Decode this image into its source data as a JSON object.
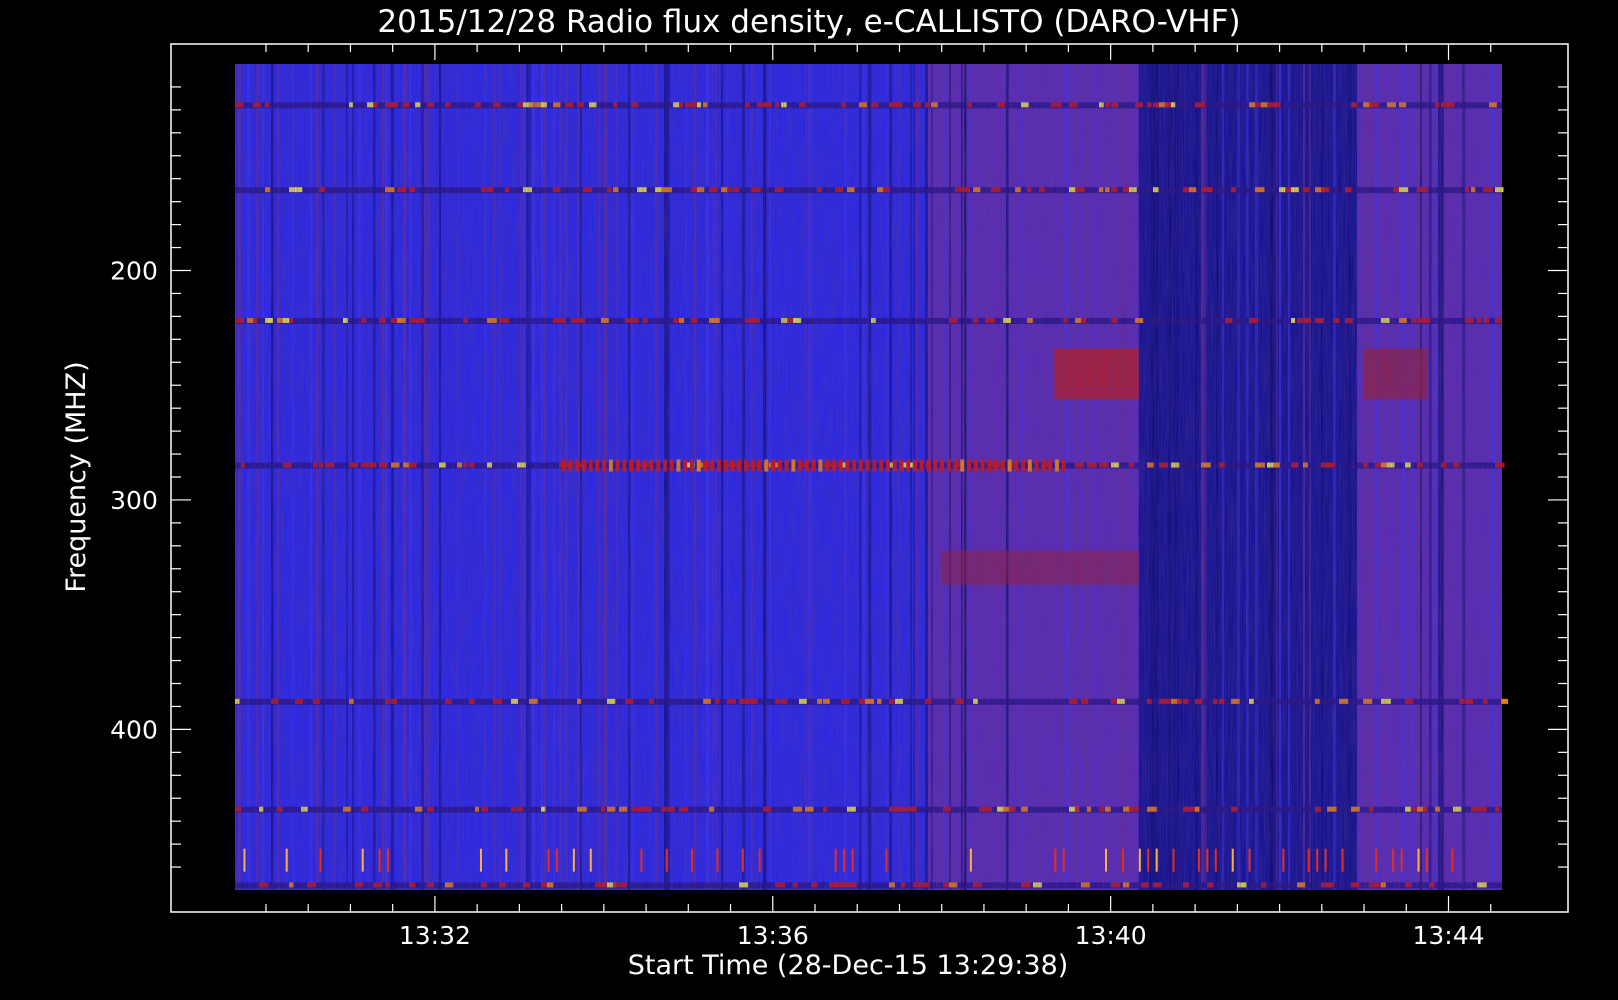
{
  "chart_data": {
    "type": "heatmap",
    "title": "2015/12/28  Radio flux density, e-CALLISTO (DARO-VHF)",
    "xlabel": "Start Time (28-Dec-15 13:29:38)",
    "ylabel": "Frequency (MHZ)",
    "x_ticks": [
      "13:32",
      "13:36",
      "13:40",
      "13:44"
    ],
    "y_ticks": [
      "200",
      "300",
      "400"
    ],
    "x_range_minutes": [
      "13:29:38",
      "13:44:38"
    ],
    "y_range_mhz": [
      110,
      470
    ],
    "colormap": [
      "#000000",
      "#1a1aff",
      "#5a2aa0",
      "#cc1010",
      "#ff8c00",
      "#ffff40"
    ],
    "segments": [
      {
        "start": "13:29:38",
        "end": "13:37:50",
        "level": "blue background"
      },
      {
        "start": "13:37:50",
        "end": "13:40:20",
        "level": "mixed red/purple"
      },
      {
        "start": "13:40:20",
        "end": "13:42:55",
        "level": "dark blue/black"
      },
      {
        "start": "13:42:55",
        "end": "13:44:38",
        "level": "mixed red/purple"
      }
    ],
    "bright_bands_mhz": [
      128,
      165,
      222,
      285,
      388,
      435,
      468
    ],
    "background_color": "#000000",
    "plot_background": "#2020ee"
  }
}
